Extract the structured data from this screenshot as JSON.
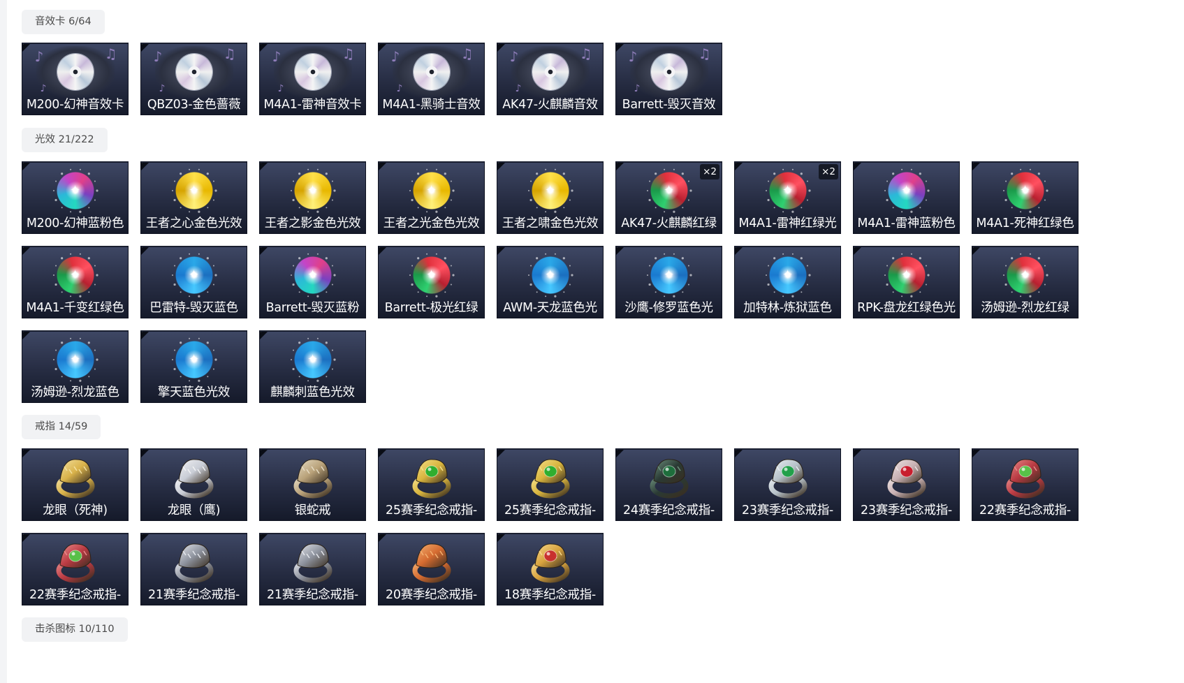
{
  "sections": [
    {
      "title": "音效卡 6/64",
      "kind": "sound",
      "items": [
        {
          "label": "M200-幻神音效卡"
        },
        {
          "label": "QBZ03-金色蔷薇"
        },
        {
          "label": "M4A1-雷神音效卡"
        },
        {
          "label": "M4A1-黑骑士音效"
        },
        {
          "label": "AK47-火麒麟音效"
        },
        {
          "label": "Barrett-毁灭音效"
        }
      ]
    },
    {
      "title": "光效 21/222",
      "kind": "glow",
      "items": [
        {
          "label": "M200-幻神蓝粉色",
          "glow": "teal-pink"
        },
        {
          "label": "王者之心金色光效",
          "glow": "gold"
        },
        {
          "label": "王者之影金色光效",
          "glow": "gold"
        },
        {
          "label": "王者之光金色光效",
          "glow": "gold"
        },
        {
          "label": "王者之啸金色光效",
          "glow": "gold"
        },
        {
          "label": "AK47-火麒麟红绿",
          "glow": "red-green",
          "badge": "×2"
        },
        {
          "label": "M4A1-雷神红绿光",
          "glow": "red-green",
          "badge": "×2"
        },
        {
          "label": "M4A1-雷神蓝粉色",
          "glow": "teal-pink"
        },
        {
          "label": "M4A1-死神红绿色",
          "glow": "red-green"
        },
        {
          "label": "M4A1-千变红绿色",
          "glow": "red-green"
        },
        {
          "label": "巴雷特-毁灭蓝色",
          "glow": "blue"
        },
        {
          "label": "Barrett-毁灭蓝粉",
          "glow": "teal-pink"
        },
        {
          "label": "Barrett-极光红绿",
          "glow": "red-green"
        },
        {
          "label": "AWM-天龙蓝色光",
          "glow": "blue"
        },
        {
          "label": "沙鹰-修罗蓝色光",
          "glow": "blue"
        },
        {
          "label": "加特林-炼狱蓝色",
          "glow": "blue"
        },
        {
          "label": "RPK-盘龙红绿色光",
          "glow": "red-green"
        },
        {
          "label": "汤姆逊-烈龙红绿",
          "glow": "red-green"
        },
        {
          "label": "汤姆逊-烈龙蓝色",
          "glow": "blue"
        },
        {
          "label": "擎天蓝色光效",
          "glow": "blue"
        },
        {
          "label": "麒麟刺蓝色光效",
          "glow": "blue"
        }
      ]
    },
    {
      "title": "戒指 14/59",
      "kind": "ring",
      "items": [
        {
          "label": "龙眼（死神)",
          "ring": "gold-dragon"
        },
        {
          "label": "龙眼（鹰)",
          "ring": "silver-dragon"
        },
        {
          "label": "银蛇戒",
          "ring": "snake"
        },
        {
          "label": "25赛季纪念戒指-",
          "ring": "green-gold"
        },
        {
          "label": "25赛季纪念戒指-",
          "ring": "green-gold"
        },
        {
          "label": "24赛季纪念戒指-",
          "ring": "dark-green"
        },
        {
          "label": "23赛季纪念戒指-",
          "ring": "silver-green"
        },
        {
          "label": "23赛季纪念戒指-",
          "ring": "silver-red"
        },
        {
          "label": "22赛季纪念戒指-",
          "ring": "red-scale"
        },
        {
          "label": "22赛季纪念戒指-",
          "ring": "red-scale"
        },
        {
          "label": "21赛季纪念戒指-",
          "ring": "tiger"
        },
        {
          "label": "21赛季纪念戒指-",
          "ring": "tiger"
        },
        {
          "label": "20赛季纪念戒指-",
          "ring": "orange-dragon"
        },
        {
          "label": "18赛季纪念戒指-",
          "ring": "gold-red"
        }
      ]
    },
    {
      "title": "击杀图标 10/110",
      "kind": "none",
      "items": []
    }
  ],
  "colors": {
    "pill_bg": "#f1f2f4",
    "pill_text": "#4a4a4a",
    "tile_top": "#3e4764",
    "tile_bottom": "#151a2a"
  }
}
